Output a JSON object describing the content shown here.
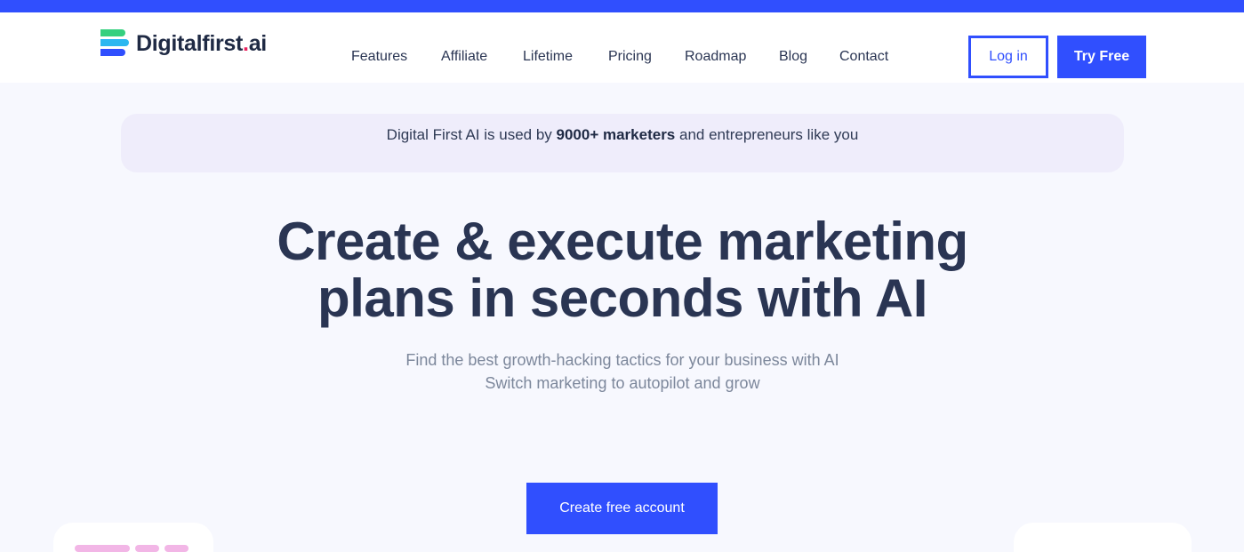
{
  "brand": {
    "name_main": "Digitalfirst",
    "name_dot": ".",
    "name_tld": "ai",
    "accent": "#304ffe",
    "dot_color": "#e9205c"
  },
  "nav": {
    "items": [
      {
        "label": "Features"
      },
      {
        "label": "Affiliate"
      },
      {
        "label": "Lifetime"
      },
      {
        "label": "Pricing"
      },
      {
        "label": "Roadmap"
      },
      {
        "label": "Blog"
      },
      {
        "label": "Contact"
      }
    ],
    "login_label": "Log in",
    "try_label": "Try Free"
  },
  "banner": {
    "prefix": "Digital First AI is used by ",
    "highlight": "9000+ marketers",
    "suffix": " and entrepreneurs like you"
  },
  "hero": {
    "title_line1": "Create & execute marketing",
    "title_line2": "plans in seconds with AI",
    "subtitle_line1": "Find the best growth-hacking tactics for your business with AI",
    "subtitle_line2": "Switch marketing to autopilot and grow",
    "cta_label": "Create free account"
  }
}
